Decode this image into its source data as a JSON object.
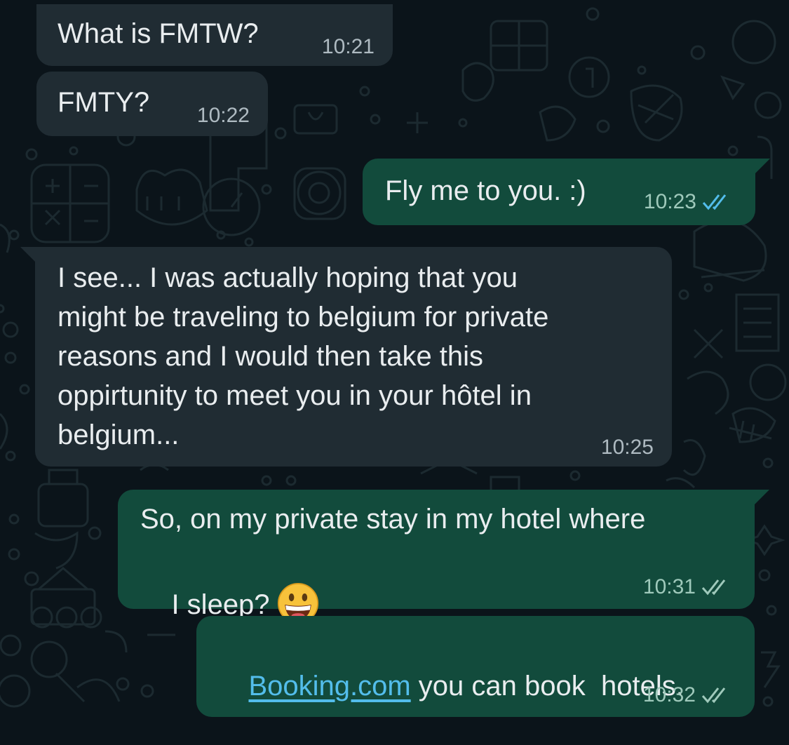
{
  "messages": [
    {
      "id": "m1",
      "direction": "incoming",
      "text": "What is FMTW?",
      "time": "10:21"
    },
    {
      "id": "m2",
      "direction": "incoming",
      "text": "FMTY?",
      "time": "10:22"
    },
    {
      "id": "m3",
      "direction": "outgoing",
      "text": "Fly me to you. :)",
      "time": "10:23",
      "status": "read"
    },
    {
      "id": "m4",
      "direction": "incoming",
      "text": "I see... I was actually hoping that you\nmight be traveling to belgium for private\nreasons and I would then take this\noppirtunity to meet you in your hôtel in\nbelgium...",
      "time": "10:25"
    },
    {
      "id": "m5",
      "direction": "outgoing",
      "text_line1": "So, on my private stay in my hotel where",
      "text_line2": "I sleep?",
      "emoji": "grinning-face-emoji",
      "time": "10:31",
      "status": "delivered"
    },
    {
      "id": "m6",
      "direction": "outgoing",
      "link": "Booking.com",
      "text": " you can book  hotels.",
      "time": "10:32",
      "status": "delivered"
    }
  ],
  "colors": {
    "background": "#0b141a",
    "incoming_bubble": "#202c33",
    "outgoing_bubble": "#124b3c",
    "read_tick": "#53bdeb",
    "link": "#53bdeb"
  }
}
